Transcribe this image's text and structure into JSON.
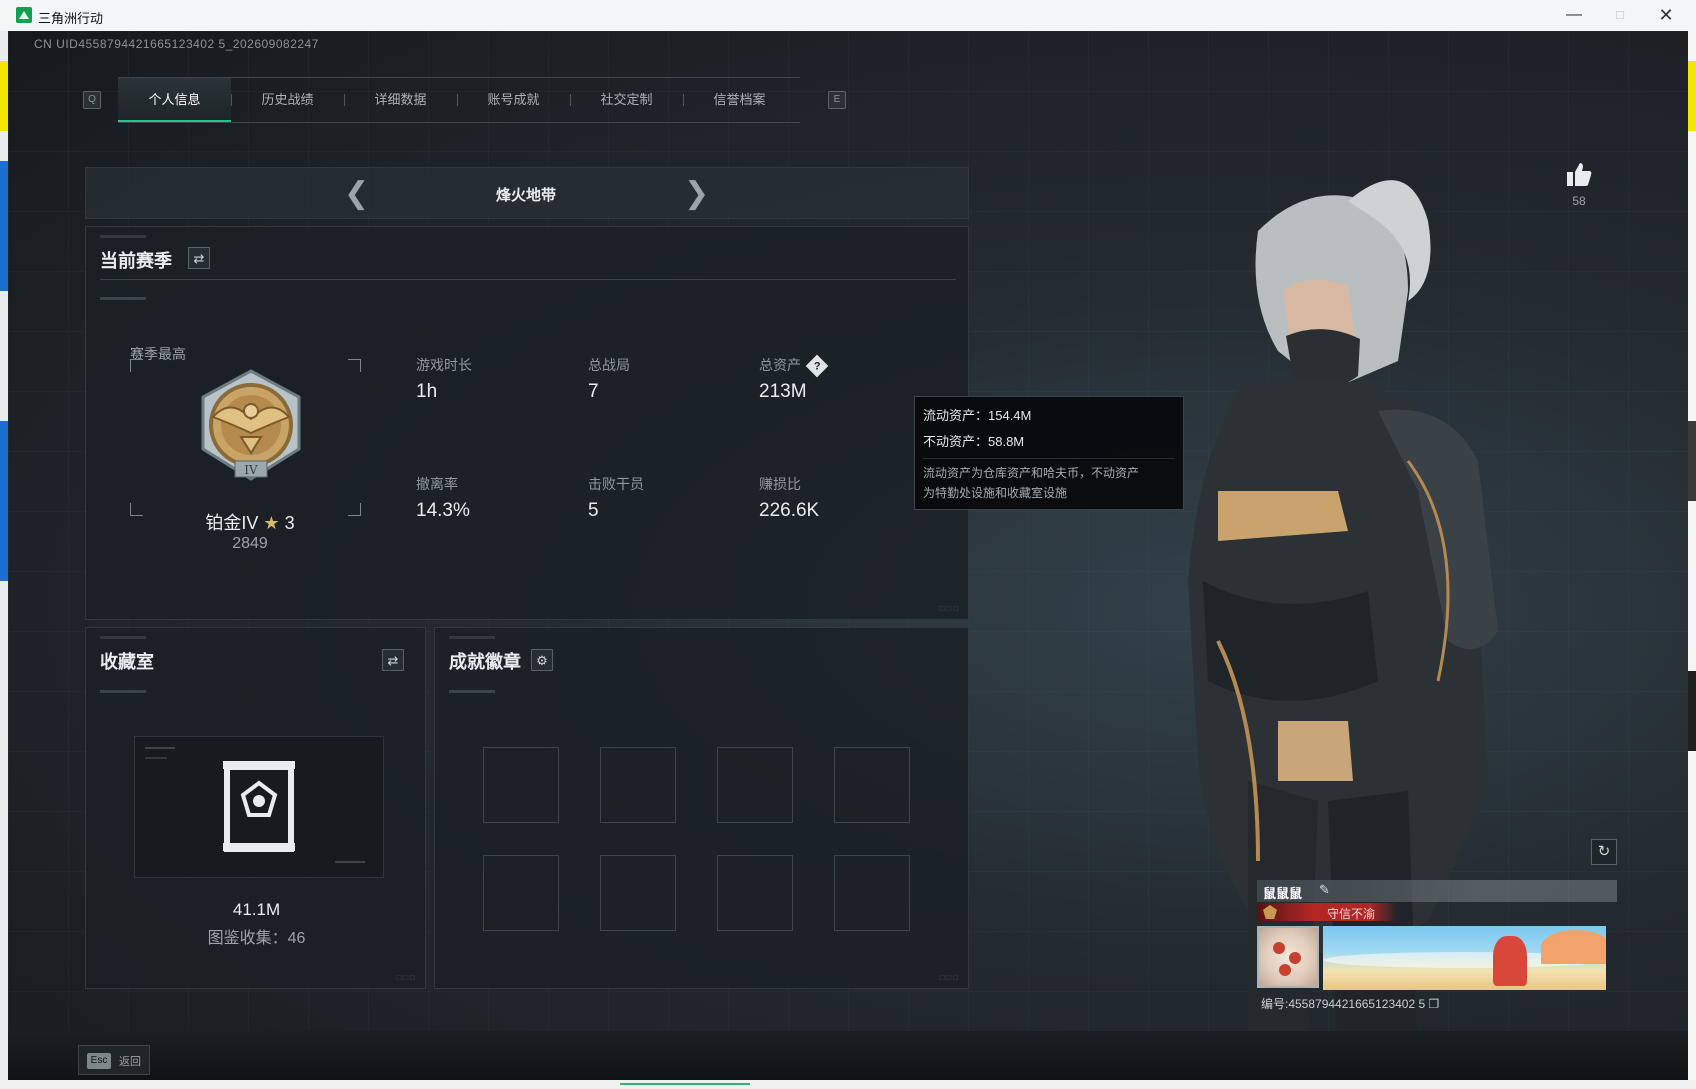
{
  "window": {
    "title": "三角洲行动"
  },
  "uid_line": "CN UID4558794421665123402 5_202609082247",
  "tabs": {
    "key_left": "Q",
    "key_right": "E",
    "items": [
      {
        "label": "个人信息",
        "active": true
      },
      {
        "label": "历史战绩"
      },
      {
        "label": "详细数据"
      },
      {
        "label": "账号成就"
      },
      {
        "label": "社交定制"
      },
      {
        "label": "信誉档案"
      }
    ]
  },
  "mode": {
    "name": "烽火地带"
  },
  "season": {
    "title": "当前赛季",
    "best_label": "赛季最高",
    "rank_name": "铂金IV",
    "rank_stars": "3",
    "rank_score": "2849",
    "stats": [
      {
        "label": "游戏时长",
        "value": "1h"
      },
      {
        "label": "总战局",
        "value": "7"
      },
      {
        "label": "总资产",
        "value": "213M"
      },
      {
        "label": "撤离率",
        "value": "14.3%"
      },
      {
        "label": "击败干员",
        "value": "5"
      },
      {
        "label": "赚损比",
        "value": "226.6K"
      }
    ]
  },
  "tooltip": {
    "liquid": "流动资产：154.4M",
    "fixed": "不动资产：58.8M",
    "note_line1": "流动资产为仓库资产和哈夫币，不动资产",
    "note_line2": "为特勤处设施和收藏室设施"
  },
  "collection": {
    "title": "收藏室",
    "value": "41.1M",
    "count_text": "图鉴收集：46"
  },
  "achievements": {
    "title": "成就徽章"
  },
  "likes": {
    "count": "58"
  },
  "card": {
    "name": "鼠鼠鼠",
    "title_text": "守信不渝",
    "id_text": "编号:4558794421665123402 5"
  },
  "footer": {
    "esc_key": "Esc",
    "esc_label": "返回"
  },
  "colors": {
    "accent": "#27c48a",
    "title_red": "#b32626"
  }
}
